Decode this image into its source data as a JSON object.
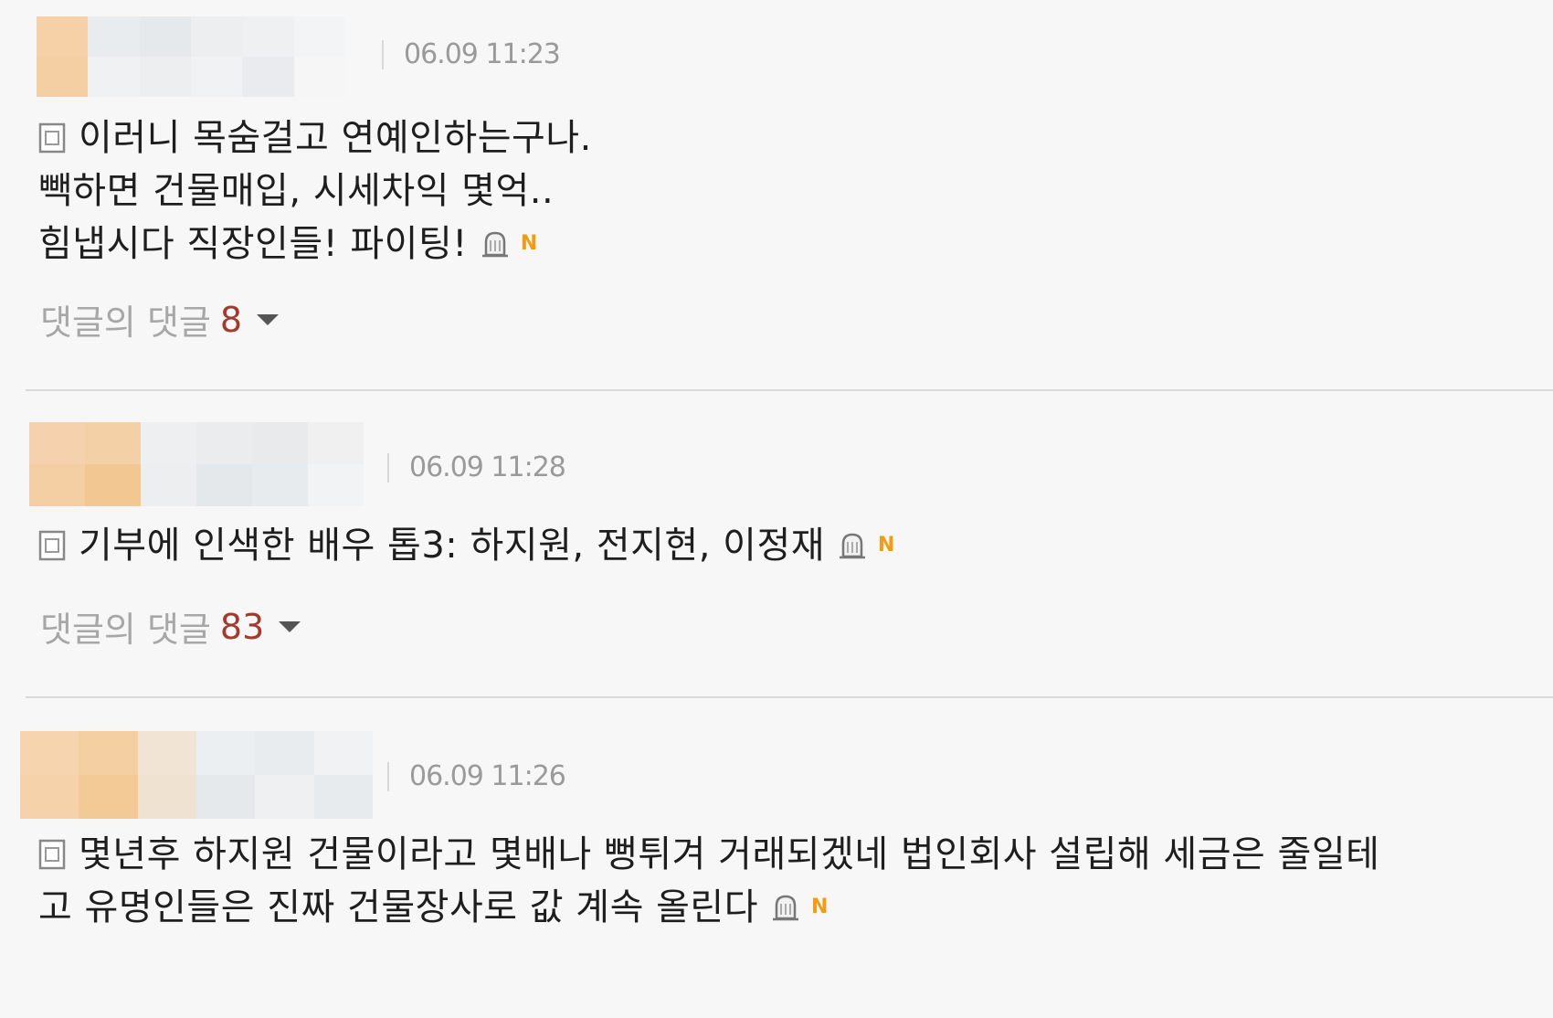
{
  "colors": {
    "background": "#f7f7f7",
    "text": "#1e1e1e",
    "meta": "#9a9a9a",
    "reply_label": "#a7a7a7",
    "reply_count": "#a23a2e",
    "new_badge": "#f39c12",
    "divider": "#d9d9d9"
  },
  "icons": {
    "memo": "memo-icon",
    "bell": "bell-icon",
    "new": "new-badge",
    "caret": "chevron-down-icon"
  },
  "comments": [
    {
      "timestamp": "06.09 11:23",
      "lines": [
        "이러니 목숨걸고 연예인하는구나.",
        "빽하면 건물매입, 시세차익 몇억..",
        "힘냅시다 직장인들! 파이팅!"
      ],
      "new_label": "N",
      "replies_label": "댓글의 댓글",
      "replies_count": "8"
    },
    {
      "timestamp": "06.09 11:28",
      "lines": [
        "기부에 인색한 배우 톱3: 하지원, 전지현, 이정재"
      ],
      "new_label": "N",
      "replies_label": "댓글의 댓글",
      "replies_count": "83"
    },
    {
      "timestamp": "06.09 11:26",
      "lines": [
        "몇년후 하지원 건물이라고 몇배나 뻥튀겨 거래되겠네 법인회사 설립해 세금은 줄일테",
        "고 유명인들은 진짜 건물장사로 값 계속 올린다"
      ],
      "new_label": "N"
    }
  ]
}
